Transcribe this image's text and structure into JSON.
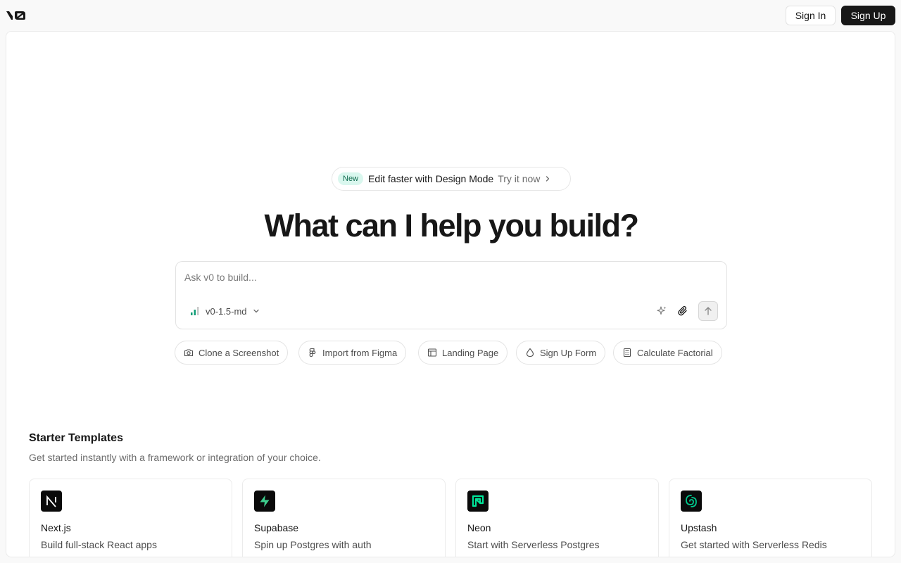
{
  "header": {
    "logo_icon": "v0-logo-icon",
    "sign_in_label": "Sign In",
    "sign_up_label": "Sign Up"
  },
  "announcement": {
    "badge": "New",
    "text": "Edit faster with Design Mode",
    "link": "Try it now"
  },
  "hero": {
    "title": "What can I help you build?"
  },
  "prompt": {
    "placeholder": "Ask v0 to build...",
    "model_label": "v0-1.5-md"
  },
  "chips": [
    {
      "label": "Clone a Screenshot",
      "icon": "camera-icon"
    },
    {
      "label": "Import from Figma",
      "icon": "figma-icon"
    },
    {
      "label": "Landing Page",
      "icon": "layout-icon"
    },
    {
      "label": "Sign Up Form",
      "icon": "drop-icon"
    },
    {
      "label": "Calculate Factorial",
      "icon": "calculator-icon"
    }
  ],
  "starter": {
    "title": "Starter Templates",
    "subtitle": "Get started instantly with a framework or integration of your choice."
  },
  "templates": [
    {
      "name": "Next.js",
      "desc": "Build full-stack React apps",
      "icon": "nextjs-icon"
    },
    {
      "name": "Supabase",
      "desc": "Spin up Postgres with auth",
      "icon": "supabase-icon"
    },
    {
      "name": "Neon",
      "desc": "Start with Serverless Postgres",
      "icon": "neon-icon"
    },
    {
      "name": "Upstash",
      "desc": "Get started with Serverless Redis",
      "icon": "upstash-icon"
    }
  ],
  "colors": {
    "accent_dark": "#171717",
    "badge_bg": "#d9f7ee",
    "supabase_green": "#3ecf8e",
    "neon_green": "#00e599",
    "upstash_green": "#00c98d"
  }
}
